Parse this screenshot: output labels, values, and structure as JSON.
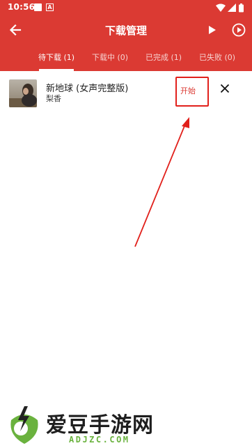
{
  "status_bar": {
    "time": "10:56",
    "a_icon_letter": "A"
  },
  "toolbar": {
    "title": "下载管理"
  },
  "tabs": [
    {
      "label": "待下载 (1)",
      "active": true
    },
    {
      "label": "下载中 (0)",
      "active": false
    },
    {
      "label": "已完成 (1)",
      "active": false
    },
    {
      "label": "已失败 (0)",
      "active": false
    }
  ],
  "downloads": [
    {
      "title": "新地球 (女声完整版)",
      "artist": "梨香",
      "action_label": "开始"
    }
  ],
  "watermark": {
    "title": "爱豆手游网",
    "subtitle": "ADJZC.COM"
  },
  "colors": {
    "primary": "#db3a33",
    "highlight": "#e1201b",
    "watermark_green": "#6ab23e"
  },
  "icons": [
    "back-arrow-icon",
    "play-icon",
    "play-circle-icon",
    "close-icon",
    "wifi-icon",
    "signal-icon",
    "battery-icon"
  ]
}
